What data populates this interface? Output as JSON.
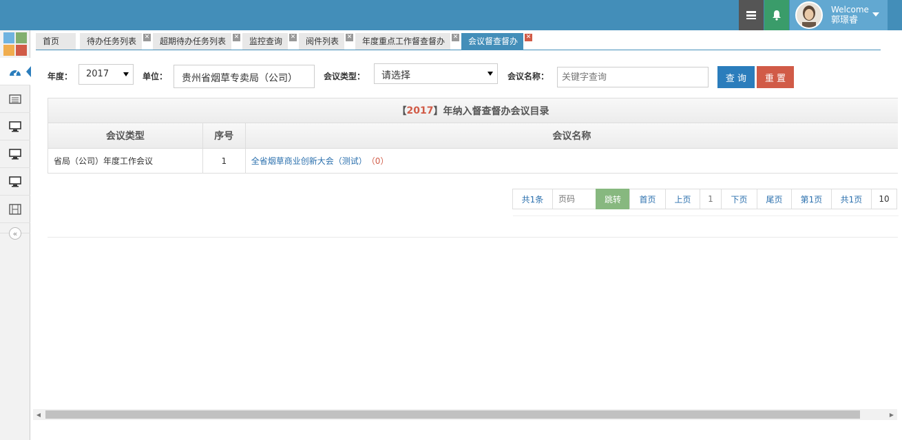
{
  "header": {
    "welcome": "Welcome",
    "username": "郭璟睿",
    "icons": [
      "tasks-icon",
      "bell-icon",
      "avatar",
      "caret-down-icon"
    ]
  },
  "sidebar": {
    "items": [
      "dashboard-icon",
      "list-icon",
      "desktop-icon",
      "desktop-icon",
      "desktop-icon",
      "film-icon"
    ],
    "collapse_label": "«"
  },
  "tabs": [
    {
      "label": "首页"
    },
    {
      "label": "待办任务列表"
    },
    {
      "label": "超期待办任务列表"
    },
    {
      "label": "监控查询"
    },
    {
      "label": "阅件列表"
    },
    {
      "label": "年度重点工作督查督办"
    },
    {
      "label": "会议督查督办"
    }
  ],
  "filter": {
    "year_label": "年度：",
    "year_value": "2017",
    "unit_label": "单位：",
    "unit_value": "贵州省烟草专卖局（公司）",
    "type_label": "会议类型：",
    "type_value": "请选择",
    "name_label": "会议名称：",
    "name_placeholder": "关键字查询",
    "search_label": "查 询",
    "reset_label": "重 置"
  },
  "table": {
    "title_prefix": "【",
    "title_year": "2017",
    "title_suffix": "】年纳入督查督办会议目录",
    "columns": [
      "会议类型",
      "序号",
      "会议名称"
    ],
    "rows": [
      {
        "type": "省局（公司）年度工作会议",
        "index": "1",
        "name": "全省烟草商业创新大会（测试）",
        "count": "（0）"
      }
    ]
  },
  "pager": {
    "total": "共1条",
    "page_placeholder": "页码",
    "jump": "跳转",
    "first": "首页",
    "prev": "上页",
    "current": "1",
    "next": "下页",
    "last": "尾页",
    "page_of": "第1页",
    "total_pages": "共1页",
    "page_size": "10"
  },
  "colors": {
    "brand": "#438eb9",
    "primary_button": "#2b7dbc",
    "danger_button": "#d15b47",
    "jump_button": "#87b87f"
  }
}
